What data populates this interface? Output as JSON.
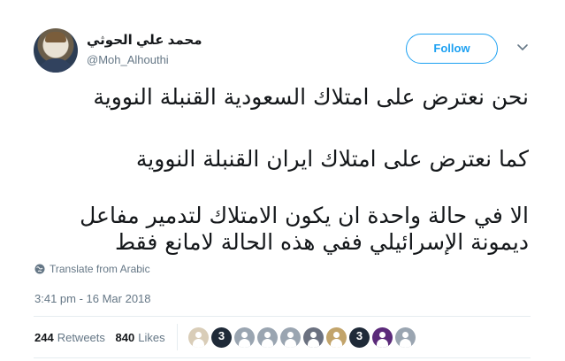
{
  "tweet": {
    "display_name": "محمد علي الحوثي",
    "handle": "@Moh_Alhouthi",
    "follow_label": "Follow",
    "lines": [
      "نحن نعترض على امتلاك السعودية القنبلة النووية",
      "كما نعترض على امتلاك ايران القنبلة النووية",
      "الا في حالة واحدة ان يكون الامتلاك لتدمير مفاعل",
      "ديمونة الإسرائيلي ففي هذه الحالة لامانع فقط"
    ],
    "translate_label": "Translate from Arabic",
    "timestamp": "3:41 pm - 16 Mar 2018"
  },
  "stats": {
    "retweets_count": "244",
    "retweets_label": "Retweets",
    "likes_count": "840",
    "likes_label": "Likes"
  },
  "likers": [
    {
      "color": "#d9cdb8",
      "badge": ""
    },
    {
      "color": "#1f2a38",
      "badge": "3"
    },
    {
      "color": "#9aa5b1",
      "badge": ""
    },
    {
      "color": "#9aa5b1",
      "badge": ""
    },
    {
      "color": "#9aa5b1",
      "badge": ""
    },
    {
      "color": "#6b7180",
      "badge": ""
    },
    {
      "color": "#c2a46b",
      "badge": ""
    },
    {
      "color": "#1f2a38",
      "badge": "3"
    },
    {
      "color": "#5b2a7a",
      "badge": ""
    },
    {
      "color": "#9aa5b1",
      "badge": ""
    }
  ],
  "colors": {
    "accent": "#1da1f2",
    "secondary_text": "#657786",
    "primary_text": "#14171a"
  }
}
